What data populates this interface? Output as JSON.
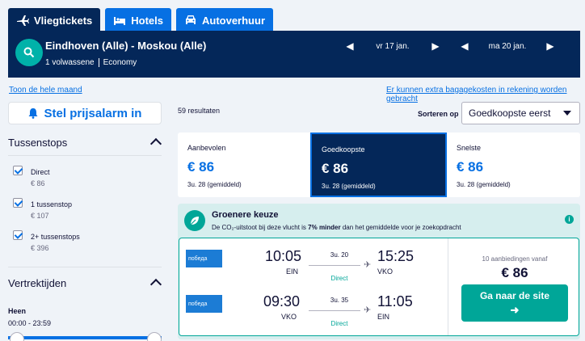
{
  "tabs": [
    {
      "label": "Vliegtickets",
      "icon": "airplane-icon"
    },
    {
      "label": "Hotels",
      "icon": "bed-icon"
    },
    {
      "label": "Autoverhuur",
      "icon": "car-icon"
    }
  ],
  "search": {
    "route": "Eindhoven (Alle) - Moskou (Alle)",
    "passengers": "1 volwassene",
    "cabin": "Economy",
    "outbound_date": "vr 17 jan.",
    "return_date": "ma 20 jan."
  },
  "links": {
    "whole_month": "Toon de hele maand",
    "baggage_note": "Er kunnen extra bagagekosten in rekening worden gebracht"
  },
  "sidebar": {
    "price_alert": "Stel prijsalarm in",
    "stops_title": "Tussenstops",
    "stops": [
      {
        "label": "Direct",
        "price": "€ 86",
        "checked": true
      },
      {
        "label": "1 tussenstop",
        "price": "€ 107",
        "checked": true
      },
      {
        "label": "2+ tussenstops",
        "price": "€ 396",
        "checked": true
      }
    ],
    "times_title": "Vertrektijden",
    "outbound_label": "Heen",
    "outbound_range": "00:00 - 23:59"
  },
  "results": {
    "count": "59 resultaten",
    "sort_label": "Sorteren op",
    "sort_value": "Goedkoopste eerst"
  },
  "sort_options": [
    {
      "label": "Aanbevolen",
      "price": "€ 86",
      "duration": "3u. 28 (gemiddeld)",
      "active": false
    },
    {
      "label": "Goedkoopste",
      "price": "€ 86",
      "duration": "3u. 28 (gemiddeld)",
      "active": true
    },
    {
      "label": "Snelste",
      "price": "€ 86",
      "duration": "3u. 28 (gemiddeld)",
      "active": false
    }
  ],
  "greener": {
    "title": "Groenere keuze",
    "text_prefix": "De CO₂-uitstoot bij deze vlucht is ",
    "text_bold": "7% minder",
    "text_suffix": " dan het gemiddelde voor je zoekopdracht"
  },
  "itinerary": {
    "legs": [
      {
        "airline": "победа",
        "depart": "10:05",
        "from": "EIN",
        "duration": "3u. 20",
        "stops": "Direct",
        "arrive": "15:25",
        "to": "VKO"
      },
      {
        "airline": "победа",
        "depart": "09:30",
        "from": "VKO",
        "duration": "3u. 35",
        "stops": "Direct",
        "arrive": "11:05",
        "to": "EIN"
      }
    ],
    "offers": "10 aanbiedingen vanaf",
    "price": "€ 86",
    "cta": "Ga naar de site"
  },
  "colors": {
    "brand": "#0770e3",
    "navy": "#042759",
    "green": "#00a698"
  }
}
